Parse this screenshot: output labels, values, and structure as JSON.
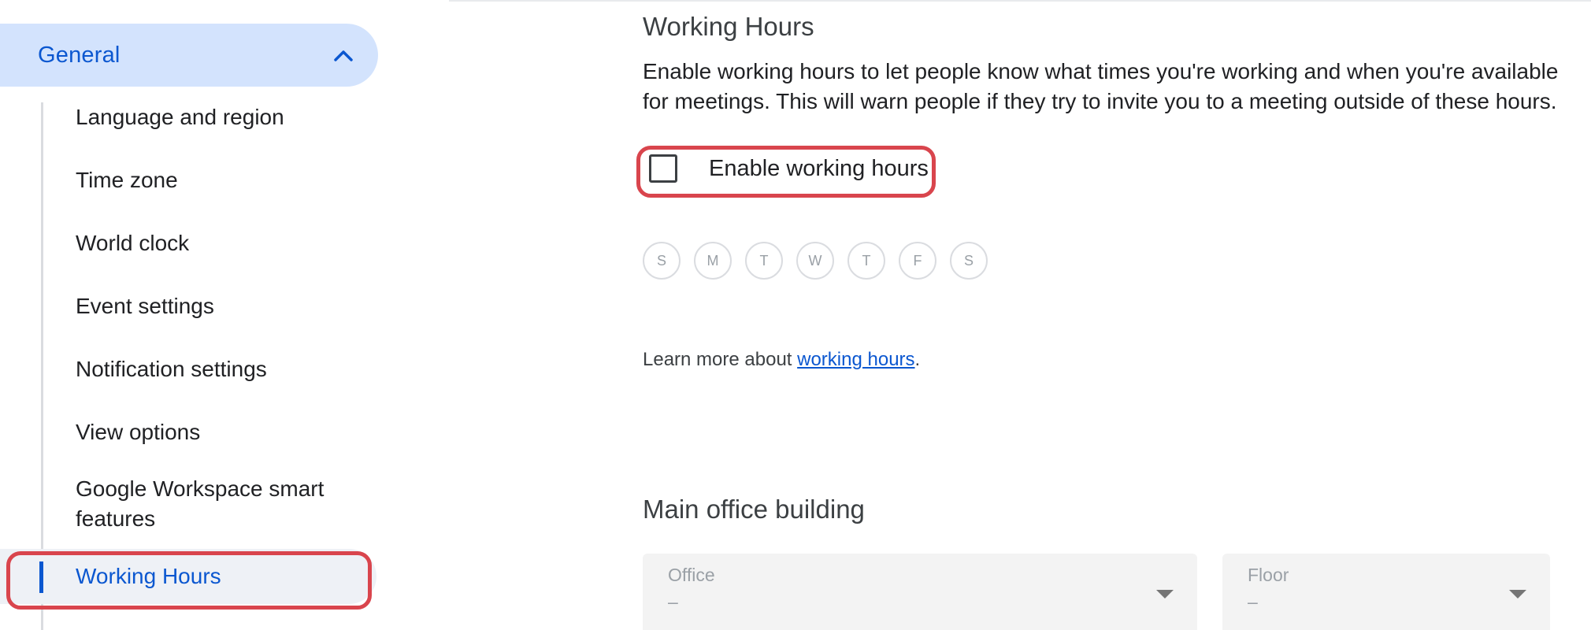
{
  "sidebar": {
    "group_label": "General",
    "items": [
      {
        "label": "Language and region"
      },
      {
        "label": "Time zone"
      },
      {
        "label": "World clock"
      },
      {
        "label": "Event settings"
      },
      {
        "label": "Notification settings"
      },
      {
        "label": "View options"
      },
      {
        "label": "Google Workspace smart features"
      },
      {
        "label": "Working Hours"
      }
    ]
  },
  "working_hours": {
    "title": "Working Hours",
    "description": "Enable working hours to let people know what times you're working and when you're available for meetings. This will warn people if they try to invite you to a meeting outside of these hours.",
    "checkbox_label": "Enable working hours",
    "checkbox_checked": false,
    "days": [
      "S",
      "M",
      "T",
      "W",
      "T",
      "F",
      "S"
    ],
    "learn_more_prefix": "Learn more about ",
    "learn_more_link": "working hours",
    "learn_more_suffix": "."
  },
  "main_office": {
    "title": "Main office building",
    "office_label": "Office",
    "office_value": "–",
    "floor_label": "Floor",
    "floor_value": "–"
  },
  "colors": {
    "accent": "#0b57d0",
    "highlight_outline": "#d9454d",
    "group_bg": "#d3e3fd"
  }
}
